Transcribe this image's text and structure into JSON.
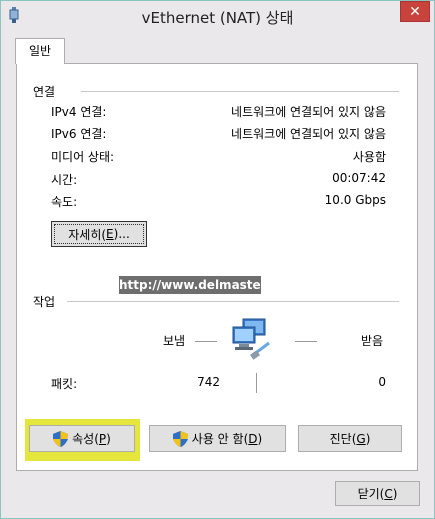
{
  "window": {
    "title": "vEthernet (NAT) 상태",
    "close_label": "✕"
  },
  "tab": {
    "label": "일반"
  },
  "connection": {
    "section_title": "연결",
    "rows": [
      {
        "label": "IPv4 연결:",
        "value": "네트워크에 연결되어 있지 않음"
      },
      {
        "label": "IPv6 연결:",
        "value": "네트워크에 연결되어 있지 않음"
      },
      {
        "label": "미디어 상태:",
        "value": "사용함"
      },
      {
        "label": "시간:",
        "value": "00:07:42"
      },
      {
        "label": "속도:",
        "value": "10.0 Gbps"
      }
    ],
    "details_button": {
      "text": "자세히(",
      "key": "E",
      "suffix": ")..."
    }
  },
  "watermark": "http://www.delmaster.net",
  "activity": {
    "section_title": "작업",
    "sent_label": "보냄",
    "received_label": "받음",
    "packets_label": "패킷:",
    "packets_sent": "742",
    "packets_received": "0"
  },
  "buttons": {
    "properties": {
      "text": "속성(",
      "key": "P",
      "suffix": ")"
    },
    "disable": {
      "text": "사용 안 함(",
      "key": "D",
      "suffix": ")"
    },
    "diagnose": {
      "text": "진단(",
      "key": "G",
      "suffix": ")"
    },
    "close": {
      "text": "닫기(",
      "key": "C",
      "suffix": ")"
    }
  },
  "icons": {
    "app": "network-adapter-icon",
    "network": "network-computers-icon",
    "shield": "uac-shield-icon"
  },
  "colors": {
    "highlight": "#e4e63b",
    "close_button": "#c8433b",
    "window_border": "#8bc5c0"
  }
}
